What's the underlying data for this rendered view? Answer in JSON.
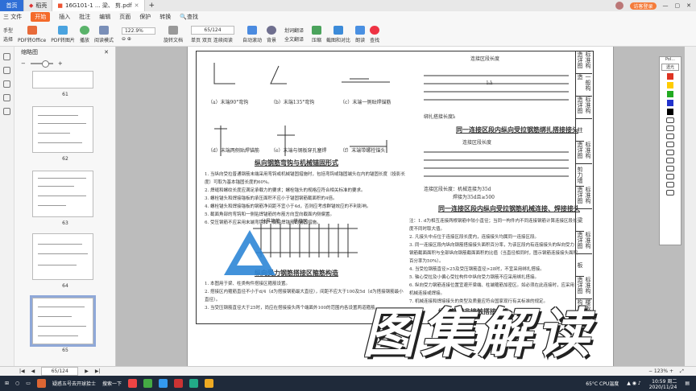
{
  "tabs": {
    "home": "首页",
    "tab1": "稻壳",
    "tab2": "16G101-1 ... 梁、 剪.pdf"
  },
  "window": {
    "login": "访客登录"
  },
  "menu": {
    "file": "三 文件",
    "open": "开始",
    "insert": "插入",
    "annotate": "批注",
    "edit": "编辑",
    "page": "页面",
    "protect": "保护",
    "convert": "转换",
    "search": "查找"
  },
  "toolbar": {
    "hand": "手型",
    "select": "选择",
    "pdf_office": "PDF转Office",
    "pdf_image": "PDF转图片",
    "play": "播放",
    "read_mode": "阅读模式",
    "zoom": "122.9%",
    "rotate": "旋转文档",
    "page_value": "65",
    "page_total": "/124",
    "single": "单页",
    "double": "双页",
    "continuous": "连续阅读",
    "auto_scroll": "自动滚动",
    "background": "背景",
    "translate_word": "划词翻译",
    "translate_full": "全文翻译",
    "compress": "压缩",
    "screenshot": "截图和对比",
    "read": "朗读",
    "find": "查找"
  },
  "thumbs": {
    "title": "缩略图",
    "pages": [
      "61",
      "62",
      "63",
      "64",
      "65"
    ]
  },
  "status": {
    "page_value": "65",
    "page_total": "/124",
    "zoom": "123%"
  },
  "taskbar": {
    "app1": "疑惑五号去开球拾士",
    "app2": "搜索一下",
    "temp": "65°C",
    "cpu": "CPU温度",
    "time": "10:59 周二",
    "date": "2020/11/24"
  },
  "palette": {
    "title": "Pol...",
    "color": "透光"
  },
  "watermark": "图集解读",
  "doc": {
    "side_labels": [
      "标准构造详图",
      "一般构造",
      "标准构造详图",
      "柱",
      "标准构造详图",
      "剪力墙",
      "标准构造详图",
      "梁",
      "标准构造详图",
      "板",
      "标准构造详图",
      "楼板相关构造"
    ],
    "fig_a": "（a）末端90°弯钩",
    "fig_b": "（b）末端135°弯钩",
    "fig_c": "（c）末端一侧贴焊锚筋",
    "fig_d": "（d）末端两侧贴焊锚筋",
    "fig_e": "（e）末端与钢板穿孔塞焊",
    "fig_f": "（f）末端带螺栓锚头",
    "title1": "纵向钢筋弯钩与机械锚固形式",
    "title2": "纵向受力钢筋搭接区箍筋构造",
    "title3": "同一连接区段内纵向受拉钢筋绑扎搭接接头",
    "title4": "同一连接区段内纵向受拉钢筋机械连接、焊接接头",
    "label_zone": "连接区段长度",
    "label_splice": "搭接区",
    "label_dia": "分界箍筋",
    "note_left": [
      "1. 当纵向受拉普通钢筋末端采用弯钩或机械锚固措施时，包括弯钩或锚固端头在内的锚固长度（投影长度）可取为基本锚固长度的60%。",
      "2. 焊缝和螺纹长度应满足承载力的要求；螺栓锚头的规格应符合相关标准的要求。",
      "3. 螺栓锚头和焊接锚板的承压面积不应小于锚固钢筋截面积的4倍。",
      "4. 螺栓锚头和焊接锚板的钢筋净间距不宜小于4d，否则应考虑群锚效应的不利影响。",
      "5. 截面角部的弯钩和一侧贴焊锚筋的布筋方向宜向截面内侧偏置。",
      "6. 受压钢筋不应采用末端弯钩和一侧贴焊锚筋的锚固措施。"
    ],
    "note_left2": [
      "1. 本图用于梁、柱类构件搭接区箍筋设置。",
      "2. 搭接区内箍筋直径不小于d/4（d为搭接钢筋最大直径），间距不应大于100及5d（d为搭接钢筋最小直径）。",
      "3. 当受压钢筋直径大于25时，尚应在搭接接头两个端面外100的范围内各设置两道箍筋。"
    ],
    "note_right": [
      "注：1. d为相互连接两根钢筋中较小直径；当同一构件内不同连接钢筋计算连接区段长度不同时取大值。",
      "2. 凡接头中点位于连接区段长度内，连接接头均属同一连接区段。",
      "3. 同一连接区段内纵向钢筋搭接接头面积百分率，为该区段内有连接接头的纵向受力钢筋截面面积与全部纵向钢筋截面面积的比值（当直径相同时，图示钢筋连接接头面积百分率为50%）。",
      "4. 当受拉钢筋直径>25及受压钢筋直径>28时，不宜采用绑扎搭接。",
      "5. 轴心受拉及小偏心受拉构件中纵向受力钢筋不应采用绑扎搭接。",
      "6. 纵向受力钢筋连接位置宜避开梁端、柱端箍筋加密区。如必须在此连接时，应采用机械连接或焊接。",
      "7. 机械连接和焊接接头的类型及质量应符合国家现行有关标准的规定。"
    ],
    "dim1": "l₁lₗ",
    "dim2": "绑扎搭接长度lₗ",
    "dim3": "连接区段长度：机械连接为35d",
    "dim4": "焊接为35d且≥500",
    "trunc": "纵向钢筋非接触搭接构造"
  }
}
